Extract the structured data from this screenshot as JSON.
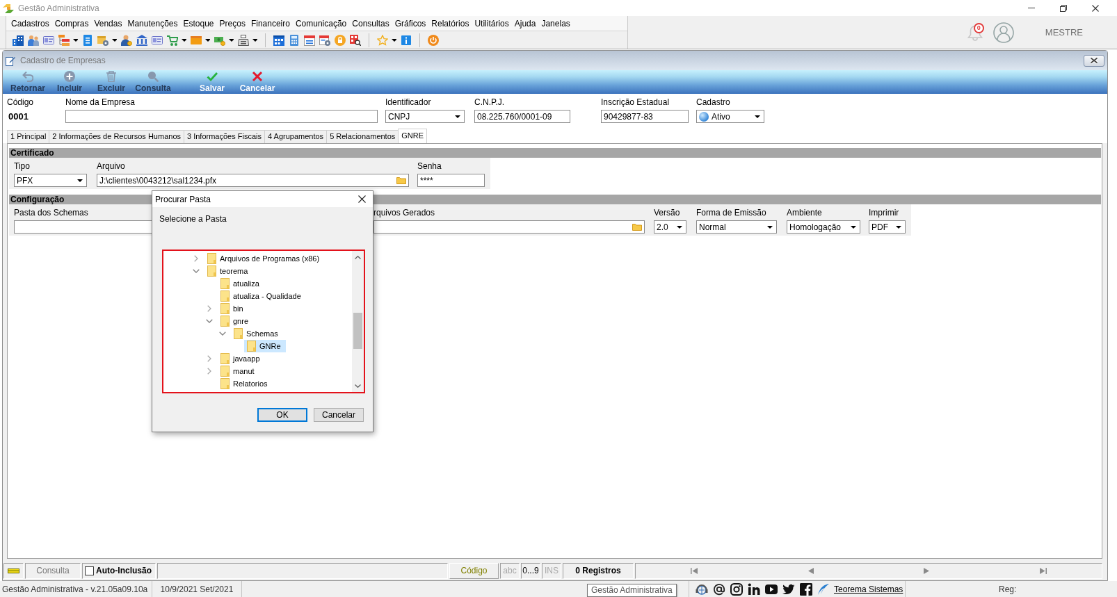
{
  "window": {
    "title": "Gestão Administrativa"
  },
  "menu": [
    "Cadastros",
    "Compras",
    "Vendas",
    "Manutenções",
    "Estoque",
    "Preços",
    "Financeiro",
    "Comunicação",
    "Consultas",
    "Gráficos",
    "Relatórios",
    "Utilitários",
    "Ajuda",
    "Janelas"
  ],
  "user_area": {
    "notification_count": "0",
    "user_name": "MESTRE"
  },
  "form": {
    "title": "Cadastro de Empresas",
    "toolbar": [
      {
        "label": "Retornar",
        "disabled": true
      },
      {
        "label": "Incluir",
        "disabled": true
      },
      {
        "label": "Excluir",
        "disabled": true
      },
      {
        "label": "Consulta",
        "disabled": true
      },
      {
        "label": "Salvar",
        "disabled": false
      },
      {
        "label": "Cancelar",
        "disabled": false
      }
    ],
    "header_fields": [
      {
        "kind": "static",
        "label": "Código",
        "value": "0001"
      },
      {
        "kind": "text",
        "label": "Nome da Empresa"
      },
      {
        "kind": "select",
        "label": "Identificador",
        "value": "CNPJ"
      },
      {
        "kind": "text",
        "label": "C.N.P.J.",
        "value": "08.225.760/0001-09"
      },
      {
        "kind": "text",
        "label": "Inscrição Estadual",
        "value": "90429877-83"
      },
      {
        "kind": "status",
        "label": "Cadastro",
        "value": "Ativo"
      }
    ],
    "tabs": [
      {
        "label": "1 Principal",
        "selected": false
      },
      {
        "label": "2 Informações de Recursos Humanos",
        "selected": false
      },
      {
        "label": "3 Informações Fiscais",
        "selected": false
      },
      {
        "label": "4 Agrupamentos",
        "selected": false
      },
      {
        "label": "5 Relacionamentos",
        "selected": false
      },
      {
        "label": "GNRE",
        "selected": true
      }
    ],
    "sections": [
      {
        "title": "Certificado",
        "fields": [
          {
            "kind": "select",
            "label": "Tipo",
            "value": "PFX"
          },
          {
            "kind": "file",
            "label": "Arquivo",
            "value": "J:\\clientes\\0043212\\sal1234.pfx"
          },
          {
            "kind": "text",
            "label": "Senha",
            "value": "****"
          }
        ]
      },
      {
        "title": "Configuração",
        "fields": [
          {
            "kind": "file",
            "label": "Pasta dos Schemas"
          },
          {
            "kind": "file",
            "label": "rquivos Gerados"
          },
          {
            "kind": "select",
            "label": "Versão",
            "value": "2.0"
          },
          {
            "kind": "select",
            "label": "Forma de Emissão",
            "value": "Normal"
          },
          {
            "kind": "select",
            "label": "Ambiente",
            "value": "Homologação"
          },
          {
            "kind": "select",
            "label": "Imprimir",
            "value": "PDF"
          }
        ]
      }
    ],
    "status_bar": {
      "mode": "Consulta",
      "auto_inclusion": {
        "label": "Auto-Inclusão",
        "checked": false
      },
      "search_field": "Código",
      "indicators": [
        {
          "label": "abc",
          "on": false
        },
        {
          "label": "0...9",
          "on": true
        },
        {
          "label": "INS",
          "on": false
        }
      ],
      "records": "0 Registros"
    }
  },
  "dialog": {
    "title": "Procurar Pasta",
    "prompt": "Selecione a Pasta",
    "tree": [
      {
        "label": "Arquivos de Programas (x86)",
        "kind": "branch",
        "expanded": false,
        "selected": false
      },
      {
        "label": "teorema",
        "kind": "branch",
        "expanded": true,
        "selected": false,
        "children": [
          {
            "label": "atualiza",
            "kind": "leaf",
            "selected": false
          },
          {
            "label": "atualiza - Qualidade",
            "kind": "leaf",
            "selected": false
          },
          {
            "label": "bin",
            "kind": "branch",
            "expanded": false,
            "selected": false
          },
          {
            "label": "gnre",
            "kind": "branch",
            "expanded": true,
            "selected": false,
            "children": [
              {
                "label": "Schemas",
                "kind": "branch",
                "expanded": true,
                "selected": false,
                "children": [
                  {
                    "label": "GNRe",
                    "kind": "leaf",
                    "selected": true
                  }
                ]
              }
            ]
          },
          {
            "label": "javaapp",
            "kind": "branch",
            "expanded": false,
            "selected": false
          },
          {
            "label": "manut",
            "kind": "branch",
            "expanded": false,
            "selected": false
          },
          {
            "label": "Relatorios",
            "kind": "leaf",
            "selected": false
          }
        ]
      }
    ],
    "buttons": [
      {
        "label": "OK",
        "default": true
      },
      {
        "label": "Cancelar",
        "default": false
      }
    ]
  },
  "footer": {
    "version": "Gestão Administrativa - v.21.05a09.10a",
    "period": "10/9/2021 Set/2021",
    "tooltip": "Gestão Administrativa",
    "link": "Teorema Sistemas",
    "reg_label": "Reg:"
  }
}
